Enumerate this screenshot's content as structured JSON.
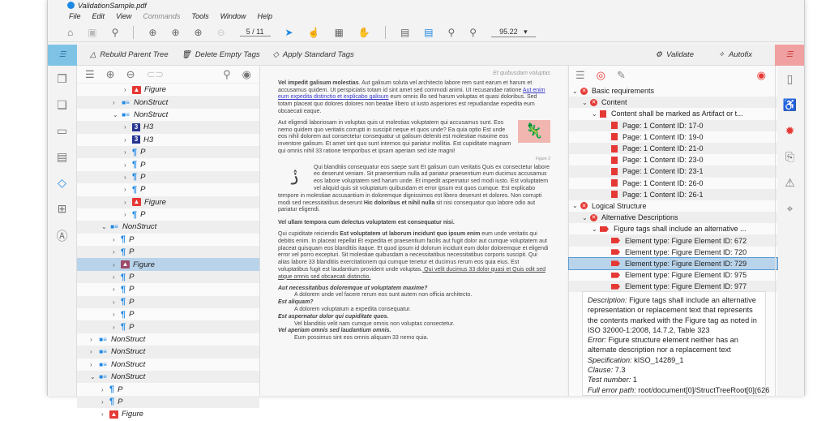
{
  "window": {
    "title": "ValidationSample.pdf"
  },
  "menu": [
    "File",
    "Edit",
    "View",
    "Commands",
    "Tools",
    "Window",
    "Help"
  ],
  "toolbar": {
    "page": "5 / 11",
    "zoom": "95.22"
  },
  "actions": {
    "rebuild": "Rebuild Parent Tree",
    "delete_empty": "Delete Empty Tags",
    "apply_standard": "Apply Standard Tags",
    "validate": "Validate",
    "autofix": "Autofix"
  },
  "tag_tree": [
    {
      "l": 5,
      "c": ">",
      "t": "fig",
      "label": "Figure"
    },
    {
      "l": 4,
      "c": ">",
      "t": "ns",
      "label": "NonStruct"
    },
    {
      "l": 4,
      "c": "v",
      "t": "ns",
      "label": "NonStruct"
    },
    {
      "l": 5,
      "c": ">",
      "t": "h",
      "label": "H3"
    },
    {
      "l": 5,
      "c": ">",
      "t": "h",
      "label": "H3"
    },
    {
      "l": 5,
      "c": ">",
      "t": "p",
      "label": "P"
    },
    {
      "l": 5,
      "c": ">",
      "t": "p",
      "label": "P"
    },
    {
      "l": 5,
      "c": ">",
      "t": "p",
      "label": "P"
    },
    {
      "l": 5,
      "c": ">",
      "t": "p",
      "label": "P"
    },
    {
      "l": 5,
      "c": ">",
      "t": "fig",
      "label": "Figure"
    },
    {
      "l": 5,
      "c": ">",
      "t": "p",
      "label": "P"
    },
    {
      "l": 3,
      "c": "v",
      "t": "ns",
      "label": "NonStruct"
    },
    {
      "l": 4,
      "c": ">",
      "t": "p",
      "label": "P"
    },
    {
      "l": 4,
      "c": ">",
      "t": "p",
      "label": "P"
    },
    {
      "l": 4,
      "c": ">",
      "t": "figsel",
      "label": "Figure",
      "sel": true
    },
    {
      "l": 4,
      "c": ">",
      "t": "p",
      "label": "P"
    },
    {
      "l": 4,
      "c": ">",
      "t": "p",
      "label": "P"
    },
    {
      "l": 4,
      "c": ">",
      "t": "p",
      "label": "P"
    },
    {
      "l": 4,
      "c": ">",
      "t": "p",
      "label": "P"
    },
    {
      "l": 4,
      "c": ">",
      "t": "p",
      "label": "P"
    },
    {
      "l": 2,
      "c": ">",
      "t": "ns",
      "label": "NonStruct"
    },
    {
      "l": 2,
      "c": ">",
      "t": "ns",
      "label": "NonStruct"
    },
    {
      "l": 2,
      "c": ">",
      "t": "ns",
      "label": "NonStruct"
    },
    {
      "l": 2,
      "c": "v",
      "t": "ns",
      "label": "NonStruct"
    },
    {
      "l": 3,
      "c": ">",
      "t": "p",
      "label": "P"
    },
    {
      "l": 3,
      "c": ">",
      "t": "p",
      "label": "P"
    },
    {
      "l": 3,
      "c": ">",
      "t": "fig",
      "label": "Figure"
    }
  ],
  "doc": {
    "running_head": "Et quibusdam voluptas",
    "p1_bold": "Vel impedit galisum molestias",
    "p1a": ". Aut galisum soluta vel architecto labore rem sunt earum et harum et accusamus quidem. Ut perspiciatis totam id sint amet sed commodi animi. Ut recusandae ratione ",
    "p1_link": "Aut enim eum expedita distinctio et explicabo galisum",
    "p1b": " eum omnis illo sed harum voluptas et quasi doloribus. Sed totam placeat quo dolores dolores non beatae libero ut iusto asperiores est repudiandae expedita eum obcaecati eaque.",
    "p2": "Aut eligendi laboriosam in voluptas quis ut molestias voluptatem qui accusamus sunt. Eos nemo quidem quo veritatis corrupti in suscipit neque et quos unde? Ea quia optio Est unde eos nihil dolorem aut consectetur consequatur ut galisum deleniti est molestiae maxime eos inventore galisum. Et amet sint quo sunt internos qui pariatur mollitia. Est cupiditate magnam qui omnis nihil 33 ratione temporibus et ipsam aperiam sed iste magni!",
    "figure_caption": "Figure 2",
    "p3a": "Qui blanditiis consequatur eos saepe sunt Et galisum cum veritatis Quis ex consectetur labore eo deserunt veniam. Sit praesentium nulla ad pariatur praesentium eum ducimus accusamus eos labore voluptatem sed harum unde. Et impedit aspernatur sed modi iusto. Est voluptatem vel aliquid quis sit voluptatum quibusdam et error ipsum est quos cumque. Est explicabo tempore in molestiae accusantium in doloremque dignissimos est libero deserunt et dolores. Non corrupti modi sed necessitatibus deserunt ",
    "p3_bold": "Hic doloribus et nihil nulla",
    "p3b": " sit nisi consequatur quo labore odio aut pariatur eligendi.",
    "h2": "Vel ullam tempora cum delectus voluptatem est consequatur nisi.",
    "p4a": "Qui cupiditate reiciendis ",
    "p4_bold": "Est voluptatem ut laborum incidunt quo ipsum enim",
    "p4b": " eum unde veritatis qui debitis enim. In placeat repellat Et expedita et praesentium facilis aut fugit dolor aut cumque voluptatem aut placeat quisquam eos blanditiis itaque. Et quod ipsum id dolorum incidunt eum dolor doloremque et eligendi error vel porro excepturi. Sit molestiae quibusdam a necessitatibus necessitatibus corporis suscipit. Qui alias labore 33 blanditiis exercitationem qui cumque tenetur et ducimus rerum eos quia eius. Est voluptatibus fugit est laudantium provident unde voluptas.",
    "p4_u": " Qui velit ducimus 33 dolor quasi et Quis odit sed atque omnis sed obcaecati distinctio.",
    "qa": [
      {
        "q": "Aut necessitatibus doloremque ut voluptatem maxime?",
        "a": "A dolorem unde vel facere rerum eos sunt autem non officia architecto."
      },
      {
        "q": "Est aliquam?",
        "a": "A dolorem voluptatum a expedita consequatur."
      },
      {
        "q": "Est aspernatur dolor qui cupiditate quos.",
        "a": "Vel blanditiis velit nam cumque omnis non voluptas consectetur."
      },
      {
        "q": "Vel aperiam omnis sed laudantium omnis.",
        "a": "Eum possimus sint eos omnis aliquam 33 nemo quia."
      }
    ]
  },
  "validation": [
    {
      "l": 0,
      "c": "v",
      "t": "x",
      "label": "Basic requirements"
    },
    {
      "l": 1,
      "c": "v",
      "t": "x",
      "label": "Content"
    },
    {
      "l": 2,
      "c": "v",
      "t": "pg",
      "label": "Content shall be marked as Artifact or t..."
    },
    {
      "l": 3,
      "c": "",
      "t": "pg",
      "label": "Page: 1 Content ID: 17-0"
    },
    {
      "l": 3,
      "c": "",
      "t": "pg",
      "label": "Page: 1 Content ID: 19-0"
    },
    {
      "l": 3,
      "c": "",
      "t": "pg",
      "label": "Page: 1 Content ID: 21-0"
    },
    {
      "l": 3,
      "c": "",
      "t": "pg",
      "label": "Page: 1 Content ID: 23-0"
    },
    {
      "l": 3,
      "c": "",
      "t": "pg",
      "label": "Page: 1 Content ID: 23-1"
    },
    {
      "l": 3,
      "c": "",
      "t": "pg",
      "label": "Page: 1 Content ID: 26-0"
    },
    {
      "l": 3,
      "c": "",
      "t": "pg",
      "label": "Page: 1 Content ID: 26-1"
    },
    {
      "l": 0,
      "c": "v",
      "t": "x",
      "label": "Logical Structure"
    },
    {
      "l": 1,
      "c": "v",
      "t": "x",
      "label": "Alternative Descriptions"
    },
    {
      "l": 2,
      "c": "v",
      "t": "tag",
      "label": "Figure tags shall include an alternative ..."
    },
    {
      "l": 3,
      "c": "",
      "t": "tag",
      "label": "Element type: Figure Element ID:  672"
    },
    {
      "l": 3,
      "c": "",
      "t": "tag",
      "label": "Element type: Figure Element ID:  720"
    },
    {
      "l": 3,
      "c": "",
      "t": "tag",
      "label": "Element type: Figure Element ID:  729",
      "sel": true
    },
    {
      "l": 3,
      "c": "",
      "t": "tag",
      "label": "Element type: Figure Element ID:  975"
    },
    {
      "l": 3,
      "c": "",
      "t": "tag",
      "label": "Element type: Figure Element ID:  977"
    }
  ],
  "details": {
    "description_label": "Description:",
    "description": " Figure tags shall include an alternative representation or replacement text that represents the contents marked with the Figure tag as noted in ISO 32000-1:2008, 14.7.2, Table 323",
    "error_label": "Error:",
    "error": " Figure structure element neither has an alternate description nor a replacement text",
    "spec_label": "Specification:",
    "spec": " kISO_14289_1",
    "clause_label": "Clause:",
    "clause": " 7.3",
    "test_label": "Test number:",
    "test": " 1",
    "path_label": "Full error path:",
    "path": " root/document[0]/StructTreeRoot[0](626"
  }
}
